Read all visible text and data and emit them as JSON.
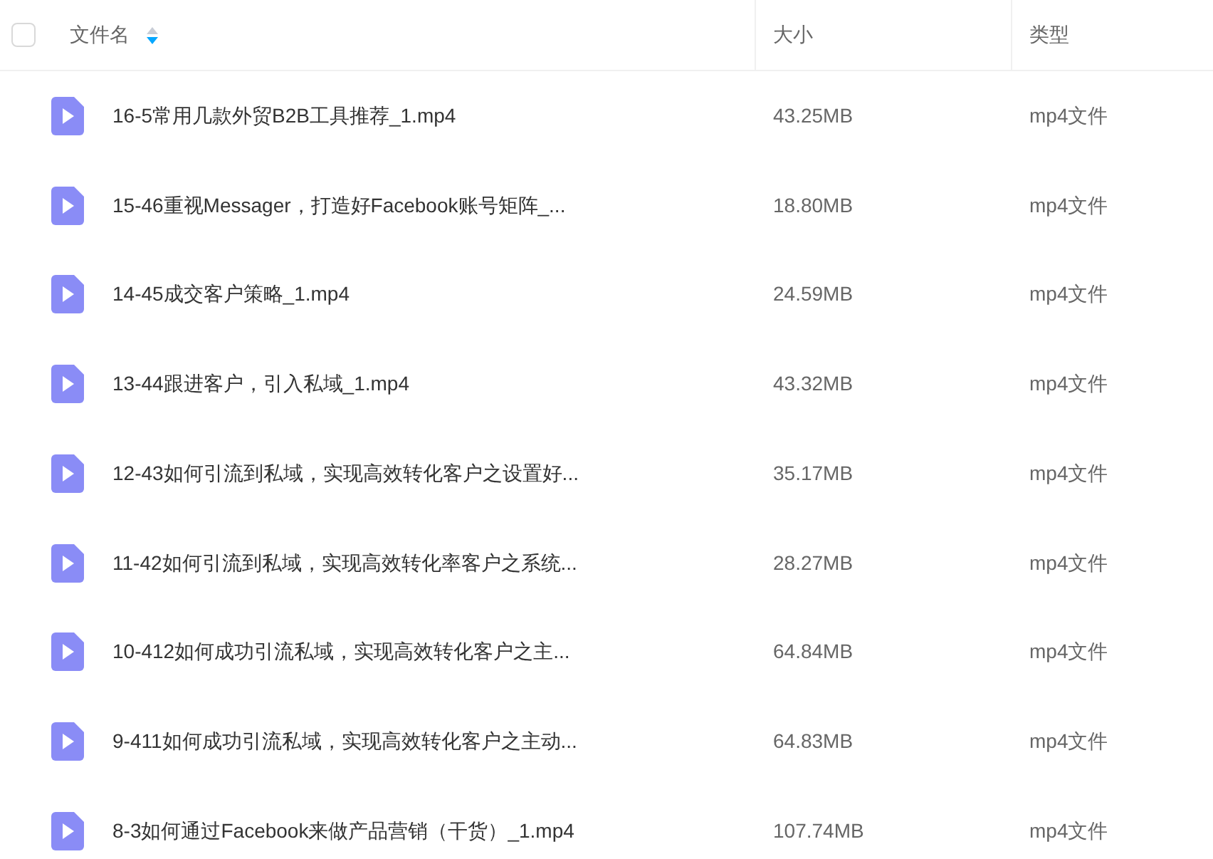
{
  "header": {
    "select_all": {
      "checked": false
    },
    "columns": [
      {
        "label": "文件名",
        "sorted_descending": true
      },
      {
        "label": "大小"
      },
      {
        "label": "类型"
      }
    ]
  },
  "rows": [
    {
      "name": "16-5常用几款外贸B2B工具推荐_1.mp4",
      "size": "43.25MB",
      "type": "mp4文件"
    },
    {
      "name": "15-46重视Messager，打造好Facebook账号矩阵_...",
      "size": "18.80MB",
      "type": "mp4文件"
    },
    {
      "name": "14-45成交客户策略_1.mp4",
      "size": "24.59MB",
      "type": "mp4文件"
    },
    {
      "name": "13-44跟进客户，引入私域_1.mp4",
      "size": "43.32MB",
      "type": "mp4文件"
    },
    {
      "name": "12-43如何引流到私域，实现高效转化客户之设置好...",
      "size": "35.17MB",
      "type": "mp4文件"
    },
    {
      "name": "11-42如何引流到私域，实现高效转化率客户之系统...",
      "size": "28.27MB",
      "type": "mp4文件"
    },
    {
      "name": "10-412如何成功引流私域，实现高效转化客户之主...",
      "size": "64.84MB",
      "type": "mp4文件"
    },
    {
      "name": "9-411如何成功引流私域，实现高效转化客户之主动...",
      "size": "64.83MB",
      "type": "mp4文件"
    },
    {
      "name": "8-3如何通过Facebook来做产品营销（干货）_1.mp4",
      "size": "107.74MB",
      "type": "mp4文件"
    }
  ]
}
